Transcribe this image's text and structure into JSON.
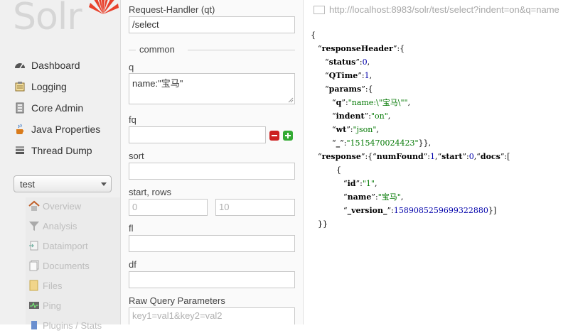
{
  "sidebar": {
    "logo_text": "Solr",
    "nav": [
      {
        "label": "Dashboard",
        "icon": "dashboard-icon"
      },
      {
        "label": "Logging",
        "icon": "logging-icon"
      },
      {
        "label": "Core Admin",
        "icon": "core-admin-icon"
      },
      {
        "label": "Java Properties",
        "icon": "java-properties-icon"
      },
      {
        "label": "Thread Dump",
        "icon": "thread-dump-icon"
      }
    ],
    "core_selector": {
      "selected": "test"
    },
    "core_menu": [
      {
        "label": "Overview",
        "icon": "home-icon"
      },
      {
        "label": "Analysis",
        "icon": "filter-icon"
      },
      {
        "label": "Dataimport",
        "icon": "dataimport-icon"
      },
      {
        "label": "Documents",
        "icon": "documents-icon"
      },
      {
        "label": "Files",
        "icon": "folder-icon"
      },
      {
        "label": "Ping",
        "icon": "ping-icon"
      },
      {
        "label": "Plugins / Stats",
        "icon": "plugins-icon"
      }
    ]
  },
  "form": {
    "request_handler_label": "Request-Handler (qt)",
    "request_handler_value": "/select",
    "common_legend": "common",
    "q_label": "q",
    "q_value": "name:\"宝马\"",
    "fq_label": "fq",
    "fq_value": "",
    "sort_label": "sort",
    "sort_value": "",
    "start_rows_label": "start, rows",
    "start_placeholder": "0",
    "rows_placeholder": "10",
    "fl_label": "fl",
    "fl_value": "",
    "df_label": "df",
    "df_value": "",
    "raw_label": "Raw Query Parameters",
    "raw_placeholder": "key1=val1&key2=val2"
  },
  "response": {
    "url": "http://localhost:8983/solr/test/select?indent=on&q=name",
    "json": {
      "responseHeader_key": "responseHeader",
      "status_key": "status",
      "status_value": "0",
      "qtime_key": "QTime",
      "qtime_value": "1",
      "params_key": "params",
      "q_key": "q",
      "q_value": "\"name:\\\"宝马\\\"\"",
      "indent_key": "indent",
      "indent_value": "\"on\"",
      "wt_key": "wt",
      "wt_value": "\"json\"",
      "underscore_key": "_",
      "underscore_value": "\"1515470024423\"",
      "response_key": "response",
      "numFound_key": "numFound",
      "numFound_value": "1",
      "start_key": "start",
      "start_value": "0",
      "docs_key": "docs",
      "id_key": "id",
      "id_value": "\"1\"",
      "name_key": "name",
      "name_value": "\"宝马\"",
      "version_key": "_version_",
      "version_value": "1589085259699322880"
    }
  },
  "colors": {
    "logo_red": "#e8412c",
    "remove_btn": "#cc2222",
    "add_btn": "#33aa33",
    "json_string": "#007700",
    "json_number": "#0000aa"
  }
}
